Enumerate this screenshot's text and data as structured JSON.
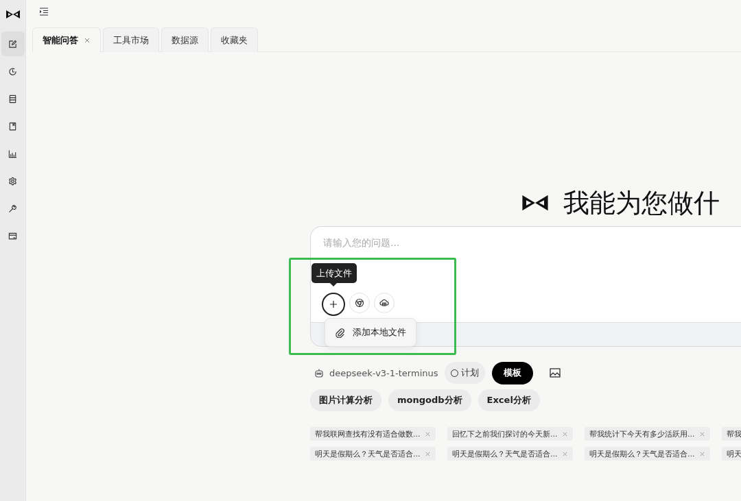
{
  "sidebar": {
    "items": [
      {
        "kind": "edit",
        "selected": true
      },
      {
        "kind": "history",
        "selected": false
      },
      {
        "kind": "database",
        "selected": false
      },
      {
        "kind": "book",
        "selected": false
      },
      {
        "kind": "chart",
        "selected": false
      },
      {
        "kind": "settings",
        "selected": false
      },
      {
        "kind": "wrench",
        "selected": false
      },
      {
        "kind": "card",
        "selected": false
      }
    ]
  },
  "tabs": [
    {
      "label": "智能问答",
      "selected": true,
      "closable": true
    },
    {
      "label": "工具市场",
      "selected": false,
      "closable": false
    },
    {
      "label": "数据源",
      "selected": false,
      "closable": false
    },
    {
      "label": "收藏夹",
      "selected": false,
      "closable": false
    }
  ],
  "headline": "我能为您做什",
  "input": {
    "placeholder": "请输入您的问题..."
  },
  "tooltip": "上传文件",
  "tool_buttons": [
    {
      "kind": "add",
      "active": true
    },
    {
      "kind": "browser",
      "active": false
    },
    {
      "kind": "cloud",
      "active": false
    }
  ],
  "menu": {
    "items": [
      {
        "label": "添加本地文件"
      }
    ]
  },
  "model": "deepseek-v3-1-terminus",
  "plan_toggle": {
    "label": "计划",
    "checked": false
  },
  "template_button": {
    "label": "模板",
    "selected": true
  },
  "quick_prompts": [
    "图片计算分析",
    "mongodb分析",
    "Excel分析"
  ],
  "history": [
    {
      "label": "帮我联网查找有没有适合做数..."
    },
    {
      "label": "回忆下之前我们探讨的今天新..."
    },
    {
      "label": "帮我统计下今天有多少活跃用..."
    },
    {
      "label": "帮我"
    },
    {
      "label": "明天是假期么？天气是否适合..."
    },
    {
      "label": "明天是假期么？天气是否适合..."
    },
    {
      "label": "明天是假期么？天气是否适合..."
    },
    {
      "label": "明天"
    }
  ]
}
